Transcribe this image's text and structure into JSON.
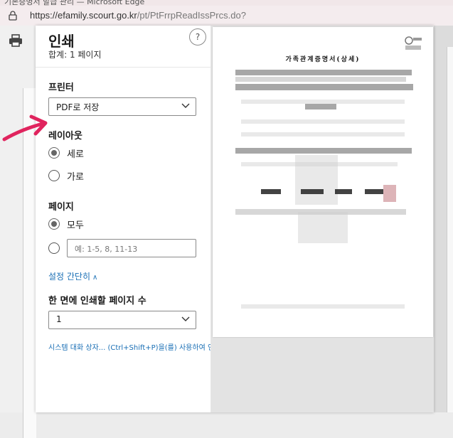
{
  "window": {
    "title": "기본증명서 발급 관리 — Microsoft Edge"
  },
  "address_bar": {
    "url_host": "https://efamily.scourt.go.kr",
    "url_path": "/pt/PtFrrpReadIssPrcs.do?"
  },
  "dialog": {
    "title": "인쇄",
    "subtitle": "합계: 1 페이지",
    "help_label": "?",
    "printer": {
      "label": "프린터",
      "value": "PDF로 저장"
    },
    "layout": {
      "label": "레이아웃",
      "options": [
        "세로",
        "가로"
      ],
      "selected": "세로"
    },
    "pages": {
      "label": "페이지",
      "all_label": "모두",
      "custom_placeholder": "예: 1-5, 8, 11-13"
    },
    "less_settings_link": "설정 간단히",
    "pages_per_sheet": {
      "label": "한 면에 인쇄할 페이지 수",
      "value": "1"
    },
    "system_dialog_link": "시스템 대화 상자... (Ctrl+Shift+P)을(를) 사용하여 인"
  },
  "preview": {
    "document_title": "가족관계증명서(상세)"
  },
  "colors": {
    "link": "#1a6fb5",
    "annotation_arrow": "#e0245e"
  },
  "icons": [
    "lock-icon",
    "printer-icon",
    "chevron-down-icon",
    "help-icon",
    "caret-up-icon",
    "seal-icon"
  ]
}
